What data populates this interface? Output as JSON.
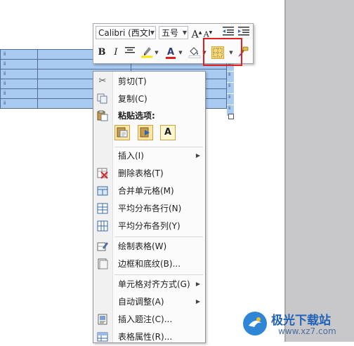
{
  "document": {
    "table_cell_marks": [
      "ⅱ",
      "ⅱ",
      "ⅱ",
      "ⅱ",
      "ⅱ",
      "ⅱ"
    ],
    "row_end_marks": [
      "ⅱ",
      "ⅱ",
      "ⅱ",
      "ⅱ",
      "ⅱ",
      "ⅱ"
    ],
    "selection_color": "#a9cbf1"
  },
  "mini_toolbar": {
    "font_name": "Calibri (西文I",
    "font_size": "五号",
    "grow_font": "A",
    "shrink_font": "A",
    "bold": "B",
    "italic": "I",
    "font_color_label": "A",
    "highlight_color": "#f6e600",
    "font_color": "#e02020",
    "borders_button_highlight_color": "#e02020"
  },
  "context_menu": {
    "items": [
      {
        "label": "剪切(T)",
        "icon": "scissors-icon"
      },
      {
        "label": "复制(C)",
        "icon": "copy-icon"
      },
      {
        "label": "粘贴选项:",
        "icon": "paste-icon"
      },
      {
        "label": "插入(I)",
        "icon": "",
        "submenu": true
      },
      {
        "label": "删除表格(T)",
        "icon": "delete-table-icon"
      },
      {
        "label": "合并单元格(M)",
        "icon": "merge-cells-icon"
      },
      {
        "label": "平均分布各行(N)",
        "icon": "distribute-rows-icon"
      },
      {
        "label": "平均分布各列(Y)",
        "icon": "distribute-columns-icon"
      },
      {
        "label": "绘制表格(W)",
        "icon": "draw-table-icon"
      },
      {
        "label": "边框和底纹(B)...",
        "icon": "borders-shading-icon"
      },
      {
        "label": "单元格对齐方式(G)",
        "icon": "",
        "submenu": true
      },
      {
        "label": "自动调整(A)",
        "icon": "",
        "submenu": true
      },
      {
        "label": "插入题注(C)...",
        "icon": "insert-caption-icon"
      },
      {
        "label": "表格属性(R)...",
        "icon": "table-properties-icon"
      }
    ],
    "paste_option_a": "A"
  },
  "watermark": {
    "title": "极光下载站",
    "url": "www.xz7.com"
  }
}
